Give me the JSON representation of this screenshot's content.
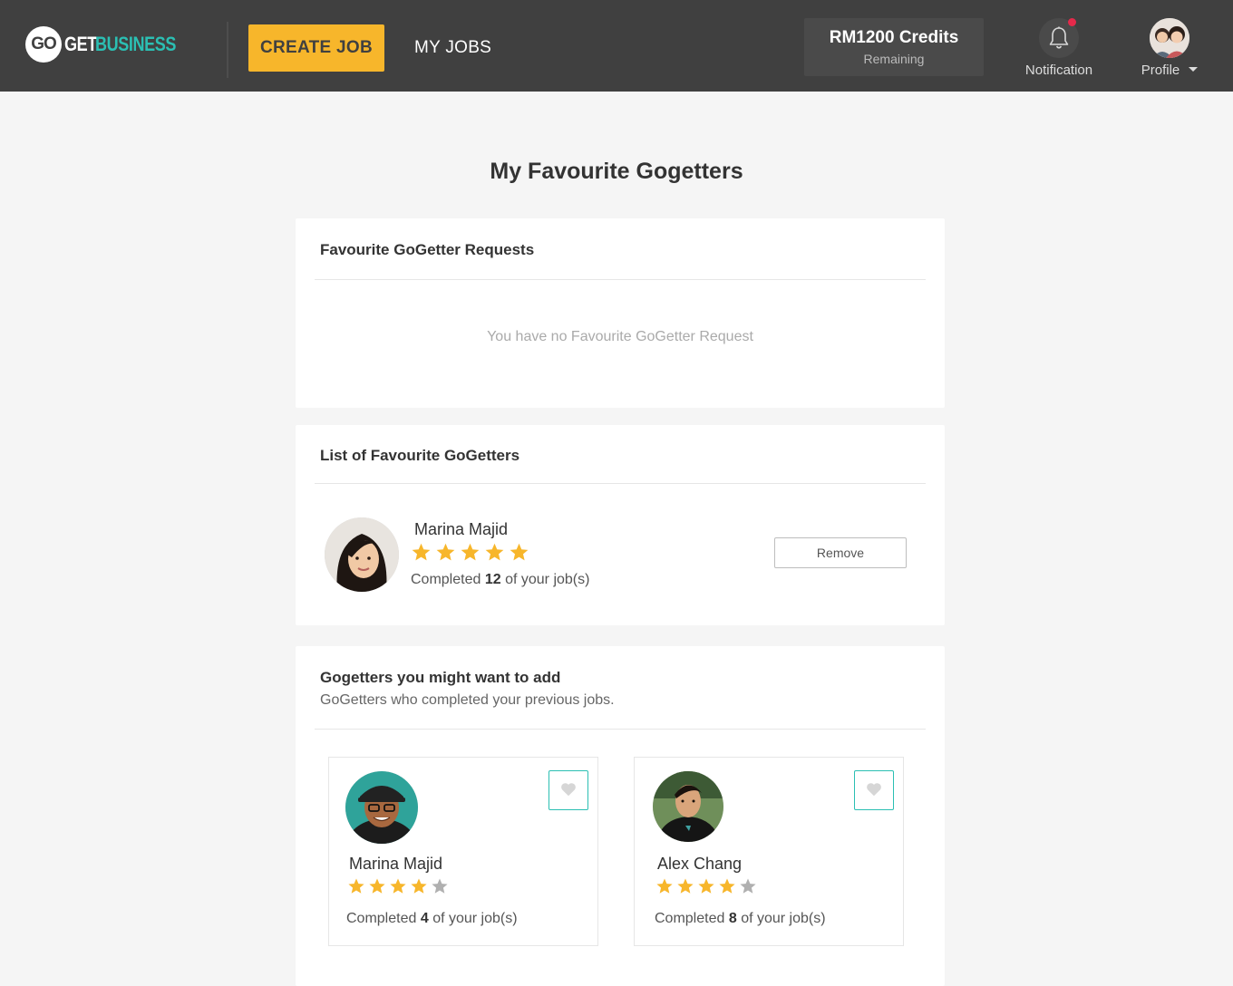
{
  "header": {
    "logo_go": "GO",
    "logo_get": "GET",
    "logo_business": "BUSINESS",
    "create_job": "CREATE JOB",
    "my_jobs": "MY JOBS",
    "credits_amount": "RM1200 Credits",
    "credits_label": "Remaining",
    "notification_label": "Notification",
    "profile_label": "Profile"
  },
  "colors": {
    "header_bg": "#404040",
    "accent_yellow": "#f7b62b",
    "accent_teal": "#2bbfb3",
    "notification_dot": "#e5294a"
  },
  "page_title": "My Favourite Gogetters",
  "requests": {
    "title": "Favourite GoGetter Requests",
    "empty_text": "You have no Favourite GoGetter Request"
  },
  "favourites": {
    "title": "List of Favourite GoGetters",
    "items": [
      {
        "name": "Marina Majid",
        "rating": 5,
        "completed_prefix": "Completed",
        "completed_count": "12",
        "completed_suffix": "of your job(s)",
        "remove_label": "Remove"
      }
    ]
  },
  "suggestions": {
    "title": "Gogetters you might want to add",
    "subtitle": "GoGetters who completed your previous jobs.",
    "items": [
      {
        "name": "Marina Majid",
        "rating": 4,
        "completed_prefix": "Completed",
        "completed_count": "4",
        "completed_suffix": "of your job(s)",
        "icon": "heart-icon"
      },
      {
        "name": "Alex Chang",
        "rating": 4,
        "completed_prefix": "Completed",
        "completed_count": "8",
        "completed_suffix": "of your job(s)",
        "icon": "heart-icon"
      }
    ]
  }
}
